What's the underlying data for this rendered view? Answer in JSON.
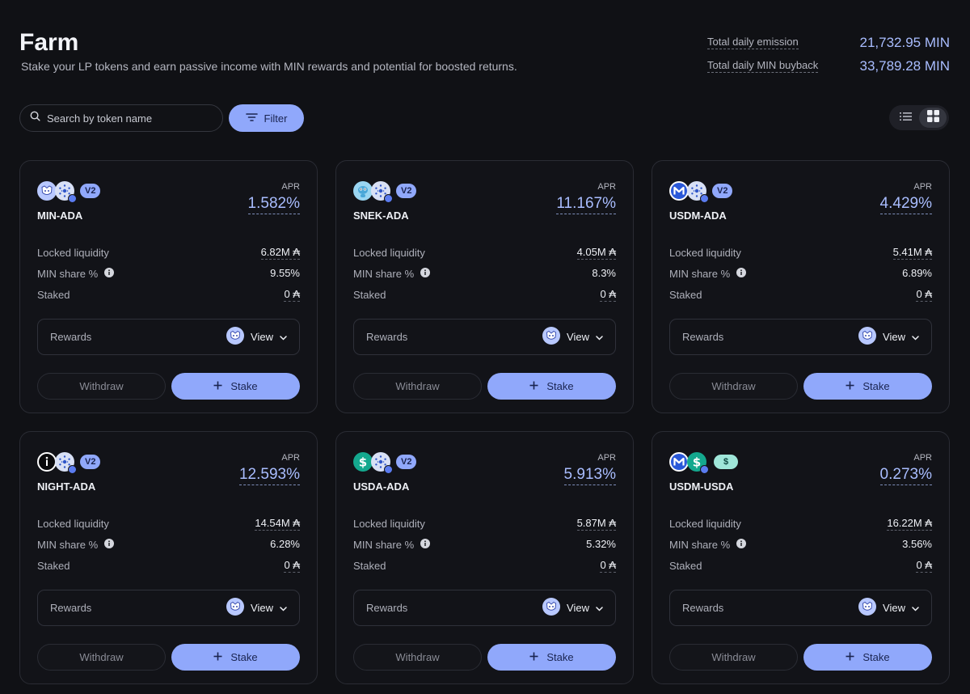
{
  "header": {
    "title": "Farm",
    "subtitle": "Stake your LP tokens and earn passive income with MIN rewards and potential for boosted returns."
  },
  "stats": [
    {
      "label": "Total daily emission",
      "value": "21,732.95 MIN"
    },
    {
      "label": "Total daily MIN buyback",
      "value": "33,789.28 MIN"
    }
  ],
  "search": {
    "placeholder": "Search by token name"
  },
  "filter": {
    "label": "Filter"
  },
  "labels": {
    "apr": "APR",
    "locked": "Locked liquidity",
    "share": "MIN share %",
    "staked": "Staked",
    "rewards": "Rewards",
    "view": "View",
    "withdraw": "Withdraw",
    "stake": "Stake"
  },
  "colors": {
    "accent": "#90a8fb",
    "accent_text": "#a9bdff",
    "background": "#101115",
    "card": "#121318"
  },
  "farms": [
    {
      "pair": "MIN-ADA",
      "badge": "V2",
      "apr": "1.582%",
      "locked": "6.82M ₳",
      "share": "9.55%",
      "staked": "0 ₳",
      "icons": [
        "min-icon",
        "ada-icon"
      ]
    },
    {
      "pair": "SNEK-ADA",
      "badge": "V2",
      "apr": "11.167%",
      "locked": "4.05M ₳",
      "share": "8.3%",
      "staked": "0 ₳",
      "icons": [
        "snek-icon",
        "ada-icon"
      ]
    },
    {
      "pair": "USDM-ADA",
      "badge": "V2",
      "apr": "4.429%",
      "locked": "5.41M ₳",
      "share": "6.89%",
      "staked": "0 ₳",
      "icons": [
        "usdm-icon",
        "ada-icon"
      ]
    },
    {
      "pair": "NIGHT-ADA",
      "badge": "V2",
      "apr": "12.593%",
      "locked": "14.54M ₳",
      "share": "6.28%",
      "staked": "0 ₳",
      "icons": [
        "night-icon",
        "ada-icon"
      ]
    },
    {
      "pair": "USDA-ADA",
      "badge": "V2",
      "apr": "5.913%",
      "locked": "5.87M ₳",
      "share": "5.32%",
      "staked": "0 ₳",
      "icons": [
        "usda-icon",
        "ada-icon"
      ]
    },
    {
      "pair": "USDM-USDA",
      "badge": "$",
      "apr": "0.273%",
      "locked": "16.22M ₳",
      "share": "3.56%",
      "staked": "0 ₳",
      "icons": [
        "usdm-icon",
        "usda-icon"
      ]
    }
  ]
}
